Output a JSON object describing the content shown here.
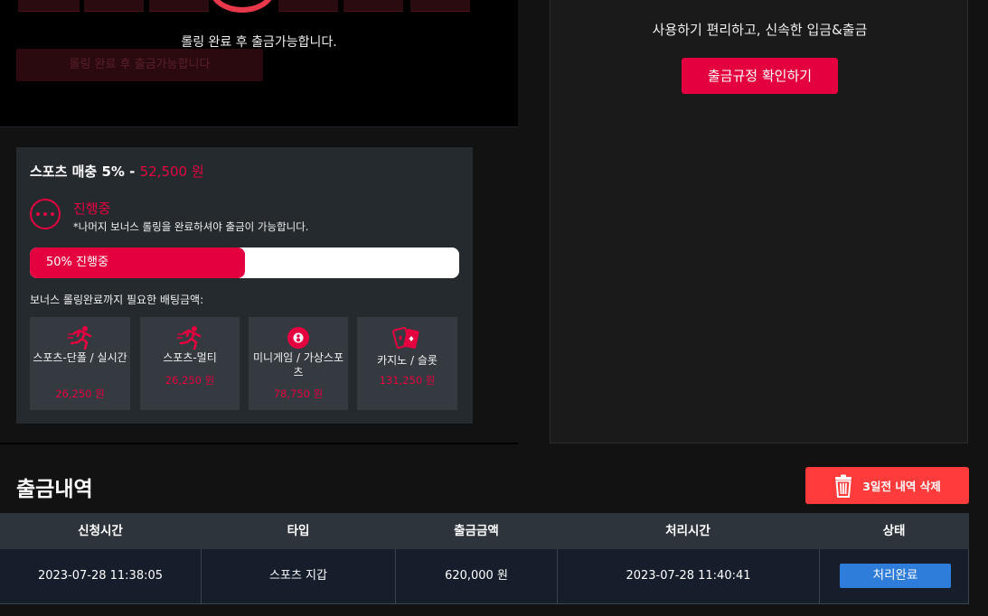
{
  "top": {
    "rolling_note": "롤링 완료 후 출금가능합니다.",
    "faded_button": "롤링 완료 후 출금가능합니다"
  },
  "right_panel": {
    "title": "사용하기 편리하고, 신속한 입금&출금",
    "rule_button": "출금규정 확인하기"
  },
  "bonus": {
    "title_prefix": "스포츠 매충 5% -",
    "amount": "52,500 원",
    "status": "진행중",
    "note": "*나머지 보너스 롤링을 완료하셔야 출금이 가능합니다.",
    "progress_percent": 50,
    "progress_label": "50% 진행중",
    "requirement_label": "보너스 롤링완료까지 필요한 배팅금액:",
    "games": [
      {
        "name": "스포츠-단폴 / 실시간",
        "amount": "26,250 원",
        "icon": "running-icon"
      },
      {
        "name": "스포츠-멀티",
        "amount": "26,250 원",
        "icon": "running-icon"
      },
      {
        "name": "미니게임 / 가상스포츠",
        "amount": "78,750 원",
        "icon": "billiard-ball-icon"
      },
      {
        "name": "카지노 / 슬롯",
        "amount": "131,250 원",
        "icon": "playing-cards-icon"
      }
    ]
  },
  "history": {
    "title": "출금내역",
    "delete_button": "3일전 내역 삭제",
    "columns": [
      "신청시간",
      "타입",
      "출금금액",
      "처리시간",
      "상태"
    ],
    "rows": [
      {
        "request_time": "2023-07-28 11:38:05",
        "type": "스포츠 지갑",
        "amount": "620,000 원",
        "processed_time": "2023-07-28 11:40:41",
        "status": "처리완료"
      }
    ]
  },
  "colors": {
    "accent": "#e4003f",
    "delete": "#ff3b3b",
    "status_done": "#2f7ddb"
  }
}
